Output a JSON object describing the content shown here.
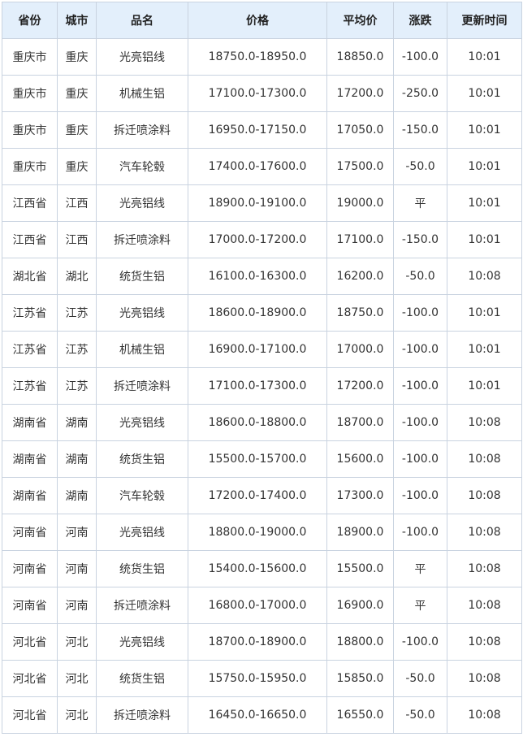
{
  "table": {
    "headers": [
      "省份",
      "城市",
      "品名",
      "价格",
      "平均价",
      "涨跌",
      "更新时间"
    ],
    "rows": [
      [
        "重庆市",
        "重庆",
        "光亮铝线",
        "18750.0-18950.0",
        "18850.0",
        "-100.0",
        "10:01"
      ],
      [
        "重庆市",
        "重庆",
        "机械生铝",
        "17100.0-17300.0",
        "17200.0",
        "-250.0",
        "10:01"
      ],
      [
        "重庆市",
        "重庆",
        "拆迁喷涂料",
        "16950.0-17150.0",
        "17050.0",
        "-150.0",
        "10:01"
      ],
      [
        "重庆市",
        "重庆",
        "汽车轮毂",
        "17400.0-17600.0",
        "17500.0",
        "-50.0",
        "10:01"
      ],
      [
        "江西省",
        "江西",
        "光亮铝线",
        "18900.0-19100.0",
        "19000.0",
        "平",
        "10:01"
      ],
      [
        "江西省",
        "江西",
        "拆迁喷涂料",
        "17000.0-17200.0",
        "17100.0",
        "-150.0",
        "10:01"
      ],
      [
        "湖北省",
        "湖北",
        "统货生铝",
        "16100.0-16300.0",
        "16200.0",
        "-50.0",
        "10:08"
      ],
      [
        "江苏省",
        "江苏",
        "光亮铝线",
        "18600.0-18900.0",
        "18750.0",
        "-100.0",
        "10:01"
      ],
      [
        "江苏省",
        "江苏",
        "机械生铝",
        "16900.0-17100.0",
        "17000.0",
        "-100.0",
        "10:01"
      ],
      [
        "江苏省",
        "江苏",
        "拆迁喷涂料",
        "17100.0-17300.0",
        "17200.0",
        "-100.0",
        "10:01"
      ],
      [
        "湖南省",
        "湖南",
        "光亮铝线",
        "18600.0-18800.0",
        "18700.0",
        "-100.0",
        "10:08"
      ],
      [
        "湖南省",
        "湖南",
        "统货生铝",
        "15500.0-15700.0",
        "15600.0",
        "-100.0",
        "10:08"
      ],
      [
        "湖南省",
        "湖南",
        "汽车轮毂",
        "17200.0-17400.0",
        "17300.0",
        "-100.0",
        "10:08"
      ],
      [
        "河南省",
        "河南",
        "光亮铝线",
        "18800.0-19000.0",
        "18900.0",
        "-100.0",
        "10:08"
      ],
      [
        "河南省",
        "河南",
        "统货生铝",
        "15400.0-15600.0",
        "15500.0",
        "平",
        "10:08"
      ],
      [
        "河南省",
        "河南",
        "拆迁喷涂料",
        "16800.0-17000.0",
        "16900.0",
        "平",
        "10:08"
      ],
      [
        "河北省",
        "河北",
        "光亮铝线",
        "18700.0-18900.0",
        "18800.0",
        "-100.0",
        "10:08"
      ],
      [
        "河北省",
        "河北",
        "统货生铝",
        "15750.0-15950.0",
        "15850.0",
        "-50.0",
        "10:08"
      ],
      [
        "河北省",
        "河北",
        "拆迁喷涂料",
        "16450.0-16650.0",
        "16550.0",
        "-50.0",
        "10:08"
      ]
    ]
  },
  "colors": {
    "header_bg": "#e3effb",
    "border": "#c9d3e0",
    "down": "#2a8f2a",
    "flat": "#333333"
  }
}
